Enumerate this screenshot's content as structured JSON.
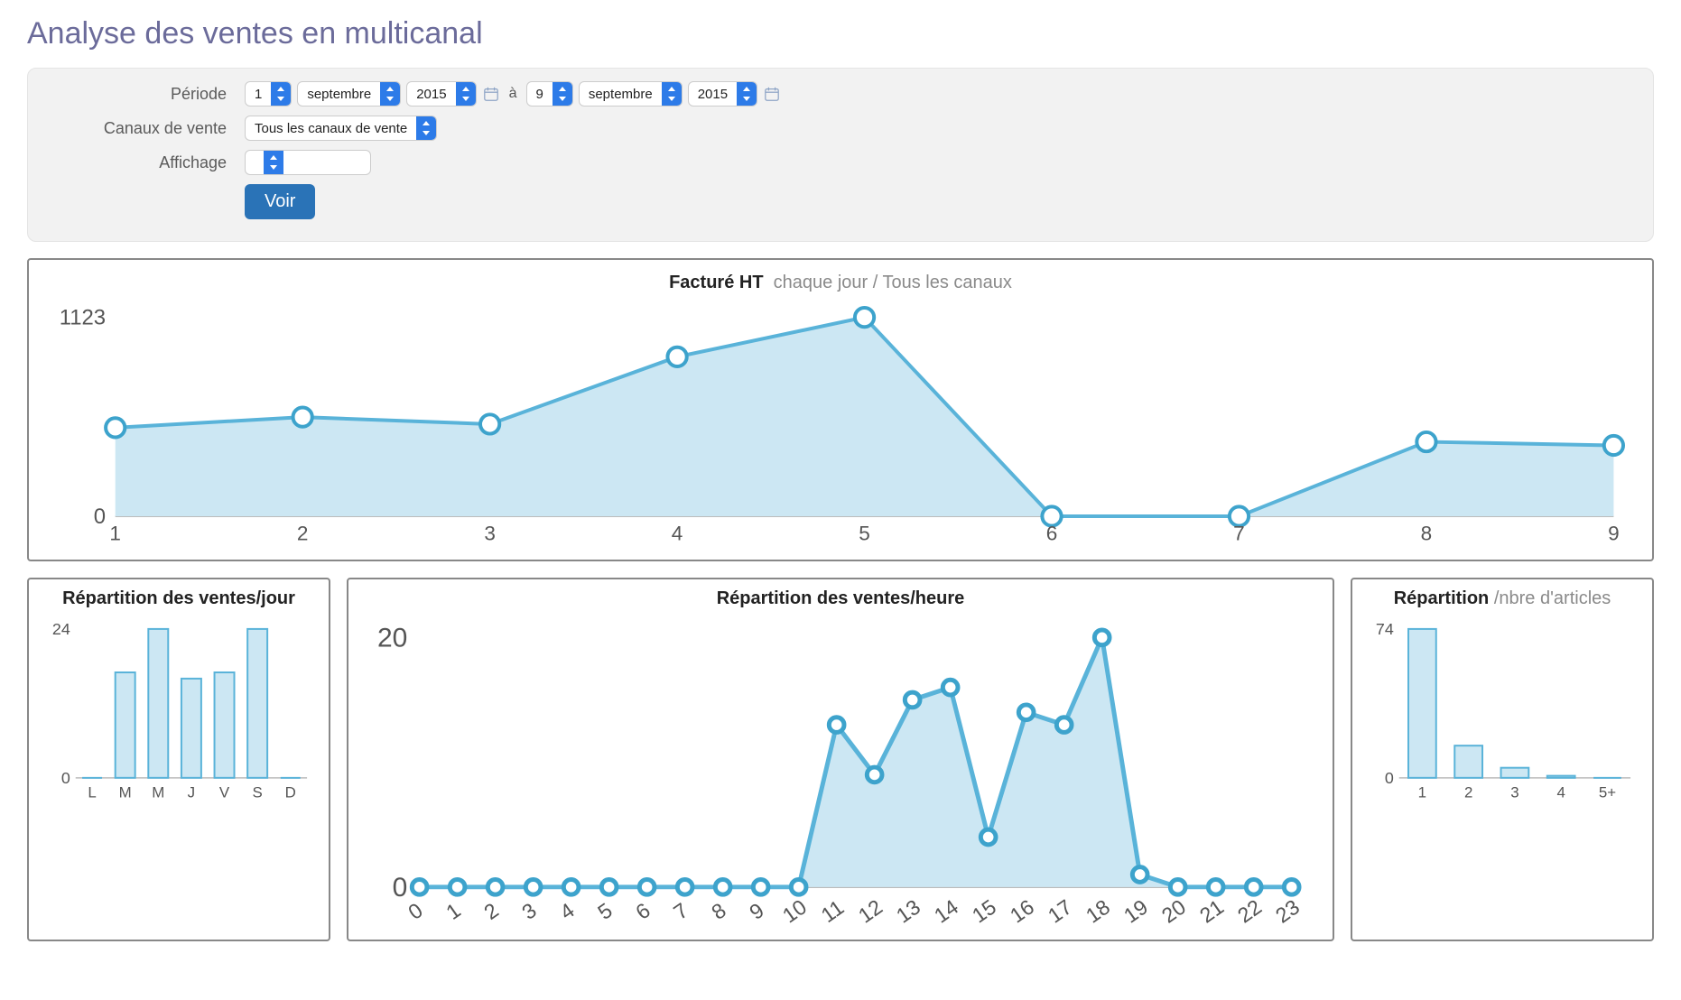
{
  "title": "Analyse des ventes en multicanal",
  "filters": {
    "period_label": "Période",
    "channels_label": "Canaux de vente",
    "display_label": "Affichage",
    "from_day": "1",
    "from_month": "septembre",
    "from_year": "2015",
    "to_sep": "à",
    "to_day": "9",
    "to_month": "septembre",
    "to_year": "2015",
    "channels_value": "Tous les canaux de vente",
    "display_value": "",
    "submit": "Voir"
  },
  "chart_data": [
    {
      "id": "main",
      "type": "area",
      "title_bold": "Facturé HT",
      "title_grey": "chaque jour / Tous les canaux",
      "x": [
        1,
        2,
        3,
        4,
        5,
        6,
        7,
        8,
        9
      ],
      "values": [
        500,
        560,
        520,
        900,
        1123,
        0,
        0,
        420,
        400
      ],
      "ylim": [
        0,
        1123
      ],
      "y_ticks": [
        0,
        1123
      ]
    },
    {
      "id": "per_day",
      "type": "bar",
      "title_bold": "Répartition des ventes/jour",
      "title_grey": "",
      "categories": [
        "L",
        "M",
        "M",
        "J",
        "V",
        "S",
        "D"
      ],
      "values": [
        0,
        17,
        24,
        16,
        17,
        24,
        0
      ],
      "ylim": [
        0,
        24
      ],
      "y_ticks": [
        0,
        24
      ]
    },
    {
      "id": "per_hour",
      "type": "area",
      "title_bold": "Répartition des ventes/heure",
      "title_grey": "",
      "x": [
        0,
        1,
        2,
        3,
        4,
        5,
        6,
        7,
        8,
        9,
        10,
        11,
        12,
        13,
        14,
        15,
        16,
        17,
        18,
        19,
        20,
        21,
        22,
        23
      ],
      "values": [
        0,
        0,
        0,
        0,
        0,
        0,
        0,
        0,
        0,
        0,
        0,
        13,
        9,
        15,
        16,
        4,
        14,
        13,
        20,
        1,
        0,
        0,
        0,
        0
      ],
      "ylim": [
        0,
        20
      ],
      "y_ticks": [
        0,
        20
      ]
    },
    {
      "id": "per_articles",
      "type": "bar",
      "title_bold": "Répartition",
      "title_grey": "/nbre d'articles",
      "categories": [
        "1",
        "2",
        "3",
        "4",
        "5+"
      ],
      "values": [
        74,
        16,
        5,
        1,
        0
      ],
      "ylim": [
        0,
        74
      ],
      "y_ticks": [
        0,
        74
      ]
    }
  ]
}
